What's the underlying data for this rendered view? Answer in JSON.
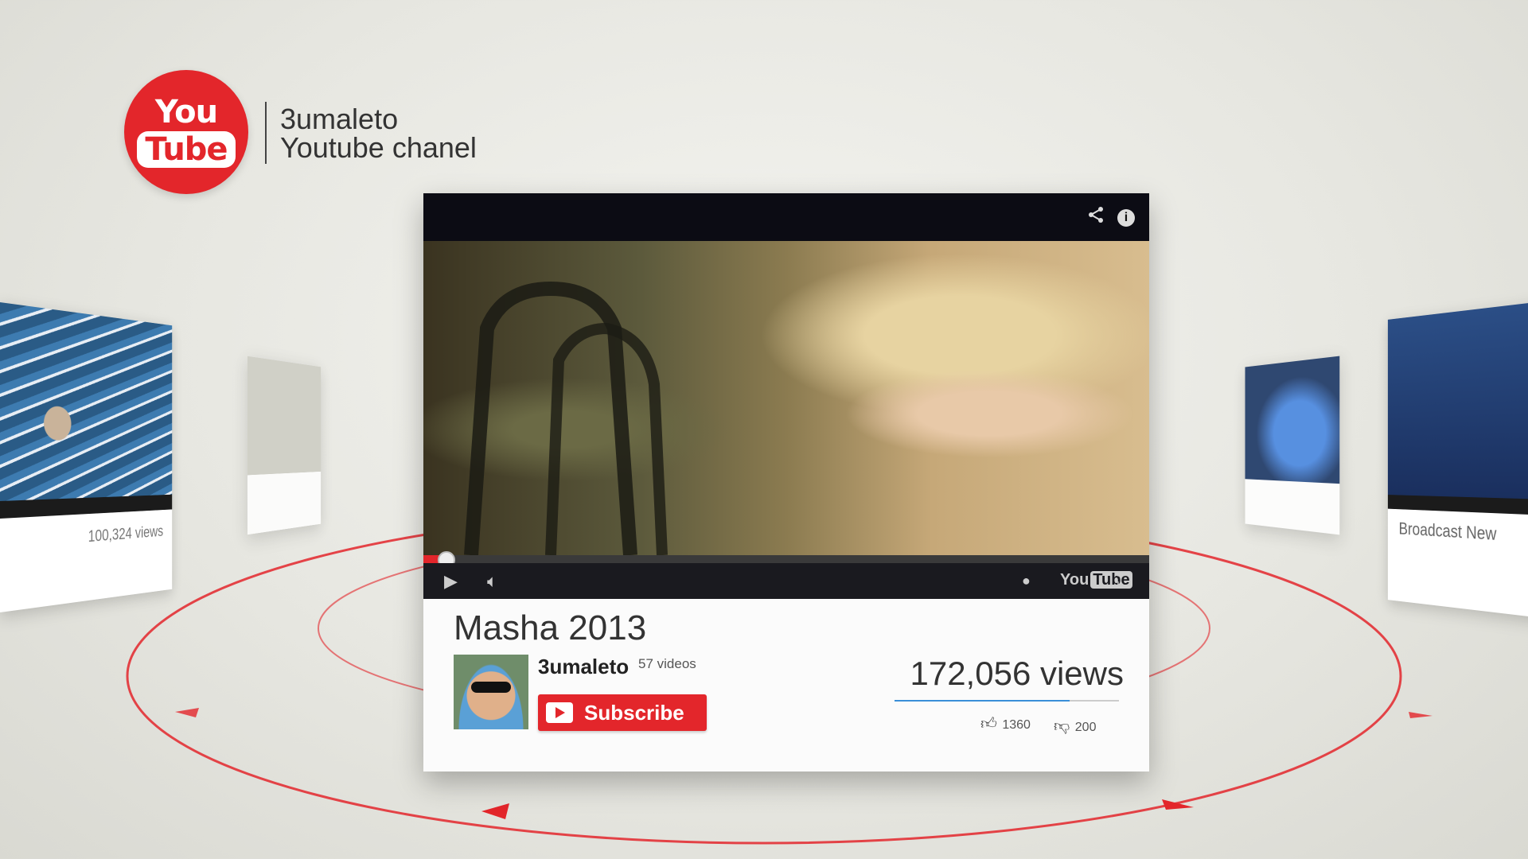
{
  "brand": {
    "logo_top": "You",
    "logo_bottom": "Tube",
    "channel_line1": "3umaleto",
    "channel_line2": "Youtube chanel",
    "accent": "#e3262b"
  },
  "main_video": {
    "title": "Masha 2013",
    "channel": "3umaleto",
    "video_count": "57 videos",
    "subscribe_label": "Subscribe",
    "views": "172,056 views",
    "likes": "1360",
    "dislikes": "200",
    "progress": 0.03,
    "views_ratio": 0.78,
    "player_logo_left": "You",
    "player_logo_right": "Tube",
    "icons": [
      "share-icon",
      "info-icon",
      "play-icon",
      "volume-icon",
      "settings-icon",
      "fullscreen-icon"
    ]
  },
  "side_cards": {
    "left_views": "100,324 views",
    "right_title": "Broadcast New"
  }
}
